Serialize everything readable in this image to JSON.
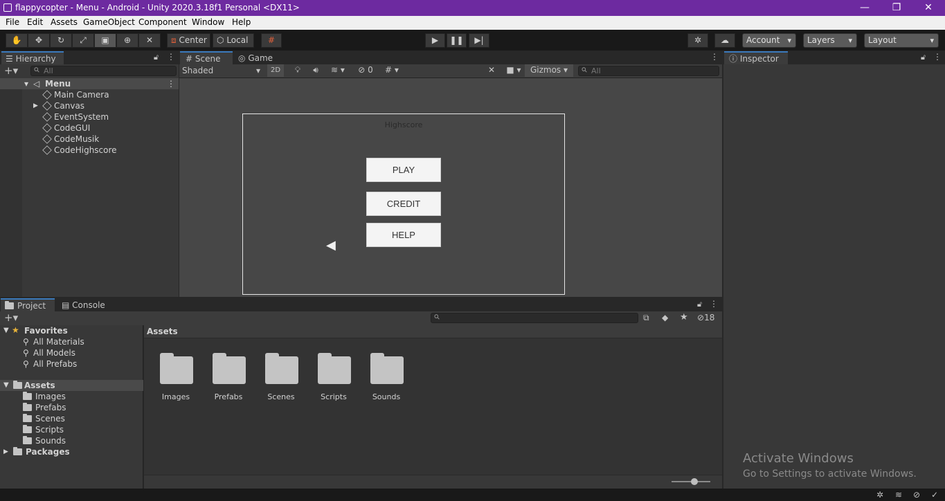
{
  "window": {
    "title": "flappycopter - Menu - Android - Unity 2020.3.18f1 Personal <DX11>"
  },
  "menu": [
    "File",
    "Edit",
    "Assets",
    "GameObject",
    "Component",
    "Window",
    "Help"
  ],
  "toolbar": {
    "center_label": "Center",
    "local_label": "Local",
    "account_label": "Account",
    "layers_label": "Layers",
    "layout_label": "Layout"
  },
  "hierarchy": {
    "tab": "Hierarchy",
    "search_placeholder": "All",
    "scene": "Menu",
    "items": [
      "Main Camera",
      "Canvas",
      "EventSystem",
      "CodeGUI",
      "CodeMusik",
      "CodeHighscore"
    ]
  },
  "scene_view": {
    "tabs": [
      "Scene",
      "Game"
    ],
    "shading": "Shaded",
    "mode_2d": "2D",
    "hidden_count": "0",
    "gizmos_label": "Gizmos",
    "search_placeholder": "All",
    "highscore_text": "Highscore",
    "buttons": [
      "PLAY",
      "CREDIT",
      "HELP"
    ]
  },
  "inspector": {
    "tab": "Inspector"
  },
  "project": {
    "tabs": [
      "Project",
      "Console"
    ],
    "hidden_count": "18",
    "favorites": {
      "label": "Favorites",
      "items": [
        "All Materials",
        "All Models",
        "All Prefabs"
      ]
    },
    "assets_label": "Assets",
    "asset_folders": [
      "Images",
      "Prefabs",
      "Scenes",
      "Scripts",
      "Sounds"
    ],
    "packages_label": "Packages",
    "breadcrumb": "Assets",
    "grid_folders": [
      "Images",
      "Prefabs",
      "Scenes",
      "Scripts",
      "Sounds"
    ]
  },
  "watermark": {
    "line1": "Activate Windows",
    "line2": "Go to Settings to activate Windows."
  }
}
